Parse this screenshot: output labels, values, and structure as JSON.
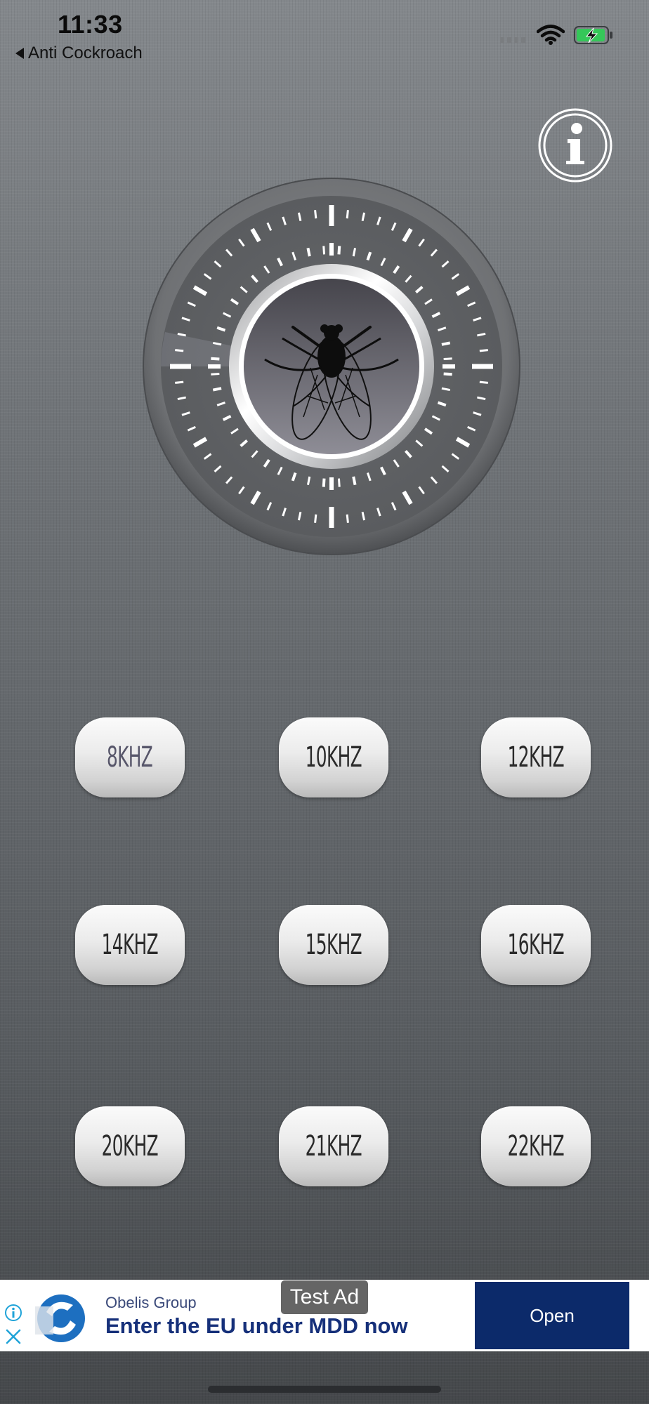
{
  "status_bar": {
    "time": "11:33",
    "back_label": "Anti Cockroach",
    "icons": [
      "signal-icon",
      "wifi-icon",
      "battery-charging-icon"
    ]
  },
  "header": {
    "info_icon": "info-icon"
  },
  "dial": {
    "icon": "fly-icon"
  },
  "frequencies": [
    {
      "label": "8KHZ",
      "active": true
    },
    {
      "label": "10KHZ",
      "active": false
    },
    {
      "label": "12KHZ",
      "active": false
    },
    {
      "label": "14KHZ",
      "active": false
    },
    {
      "label": "15KHZ",
      "active": false
    },
    {
      "label": "16KHZ",
      "active": false
    },
    {
      "label": "20KHZ",
      "active": false
    },
    {
      "label": "21KHZ",
      "active": false
    },
    {
      "label": "22KHZ",
      "active": false
    }
  ],
  "ad": {
    "test_label": "Test Ad",
    "advertiser": "Obelis Group",
    "headline": "Enter the EU under MDD now",
    "open_label": "Open",
    "icons": [
      "ad-info-icon",
      "ad-close-icon",
      "advertiser-logo"
    ]
  },
  "colors": {
    "background_top": "#84888c",
    "background_bottom": "#45484b",
    "button_face": "#e9e9e9",
    "ad_button": "#0c2a6a",
    "ad_headline": "#16307a",
    "battery_fill": "#35c759"
  }
}
